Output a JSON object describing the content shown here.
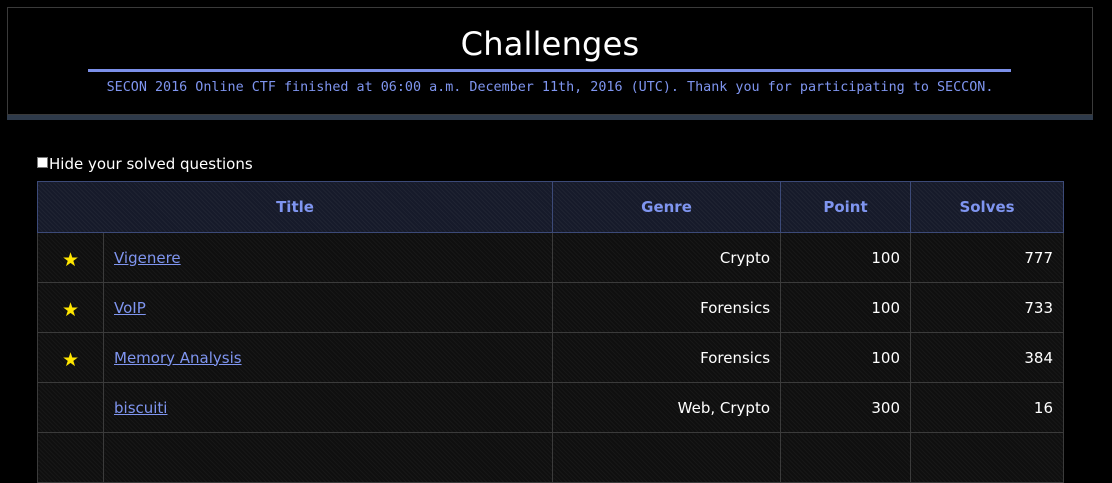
{
  "header": {
    "title": "Challenges",
    "notice": "SECON 2016 Online CTF finished at 06:00 a.m. December 11th, 2016 (UTC). Thank you for participating to SECCON."
  },
  "filter": {
    "hide_solved_label": "Hide your solved questions",
    "checked": false
  },
  "table": {
    "columns": {
      "title": "Title",
      "genre": "Genre",
      "point": "Point",
      "solves": "Solves"
    },
    "rows": [
      {
        "starred": true,
        "title": "Vigenere",
        "genre": "Crypto",
        "point": "100",
        "solves": "777"
      },
      {
        "starred": true,
        "title": "VoIP",
        "genre": "Forensics",
        "point": "100",
        "solves": "733"
      },
      {
        "starred": true,
        "title": "Memory Analysis",
        "genre": "Forensics",
        "point": "100",
        "solves": "384"
      },
      {
        "starred": false,
        "title": "biscuiti",
        "genre": "Web, Crypto",
        "point": "300",
        "solves": "16"
      },
      {
        "starred": false,
        "title": "",
        "genre": "",
        "point": "",
        "solves": ""
      }
    ]
  },
  "colors": {
    "accent": "#7f95f0",
    "star": "#ffe600",
    "background": "#000000"
  }
}
